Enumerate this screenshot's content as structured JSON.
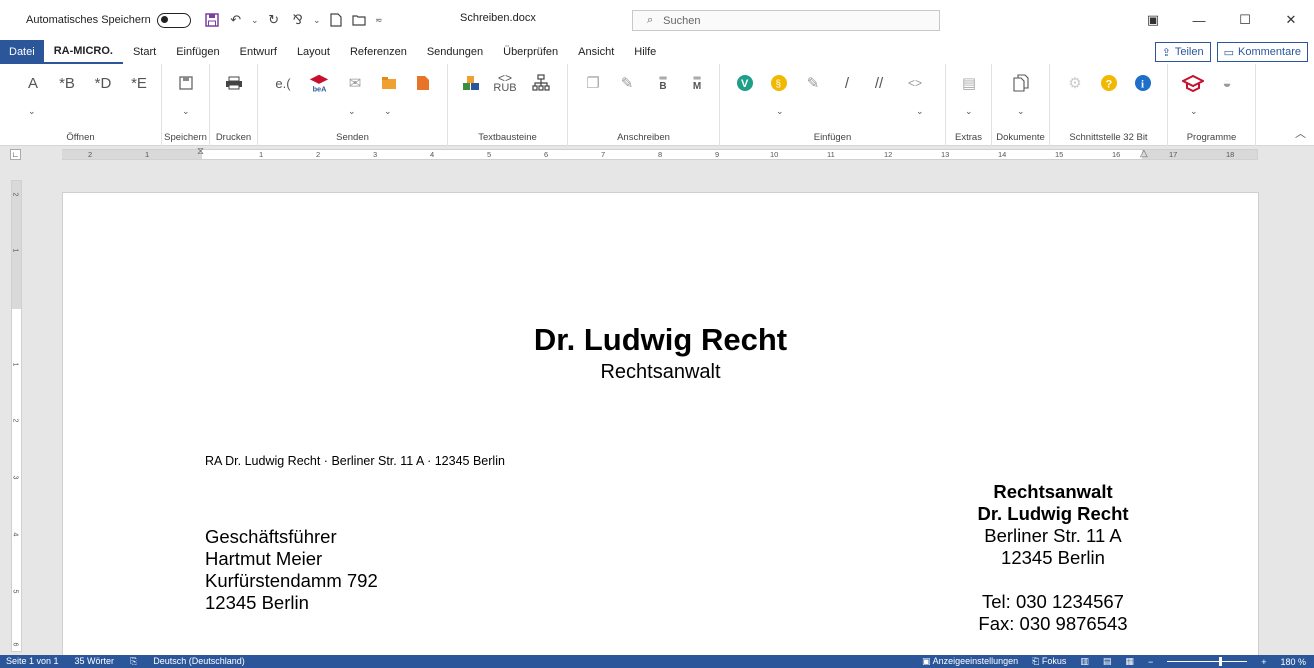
{
  "titlebar": {
    "autosave_label": "Automatisches Speichern",
    "doc_title": "Schreiben.docx",
    "search_placeholder": "Suchen"
  },
  "tabs": [
    {
      "label": "Datei"
    },
    {
      "label": "RA-MICRO."
    },
    {
      "label": "Start"
    },
    {
      "label": "Einfügen"
    },
    {
      "label": "Entwurf"
    },
    {
      "label": "Layout"
    },
    {
      "label": "Referenzen"
    },
    {
      "label": "Sendungen"
    },
    {
      "label": "Überprüfen"
    },
    {
      "label": "Ansicht"
    },
    {
      "label": "Hilfe"
    }
  ],
  "share": {
    "teilen": "Teilen",
    "kommentare": "Kommentare"
  },
  "ribbon": {
    "groups": [
      "Öffnen",
      "Speichern",
      "Drucken",
      "Senden",
      "Textbausteine",
      "Anschreiben",
      "Einfügen",
      "Extras",
      "Dokumente",
      "Schnittstelle 32 Bit",
      "Programme"
    ],
    "oeffnen_icons": [
      "A",
      "*B",
      "*D",
      "*E"
    ],
    "senden_icons": [
      "e.("
    ],
    "textbausteine_icon": "RUB",
    "anschreiben_icons": [
      "B",
      "M"
    ]
  },
  "ruler": {
    "numbers": [
      "2",
      "1",
      "1",
      "2",
      "3",
      "4",
      "5",
      "6",
      "7",
      "8",
      "9",
      "10",
      "11",
      "12",
      "13",
      "14",
      "15",
      "16",
      "17",
      "18"
    ],
    "vertical_numbers": [
      "2",
      "1",
      "1",
      "2",
      "3",
      "4",
      "5",
      "6"
    ]
  },
  "letter": {
    "name": "Dr. Ludwig Recht",
    "subtitle": "Rechtsanwalt",
    "sender_line": "RA Dr. Ludwig Recht · Berliner Str. 11 A · 12345 Berlin",
    "recipient": [
      "Geschäftsführer",
      "Hartmut Meier",
      "Kurfürstendamm 792",
      "12345 Berlin"
    ],
    "sender_block": {
      "title": "Rechtsanwalt",
      "name": "Dr. Ludwig Recht",
      "street": "Berliner Str. 11 A",
      "city": "12345 Berlin",
      "tel": "Tel: 030 1234567",
      "fax": "Fax: 030 9876543"
    }
  },
  "status": {
    "page": "Seite 1 von 1",
    "words": "35 Wörter",
    "language": "Deutsch (Deutschland)",
    "display_settings": "Anzeigeeinstellungen",
    "focus": "Fokus",
    "zoom": "180 %"
  },
  "colors": {
    "accent": "#2b579a",
    "save_icon": "#7b3fa0"
  }
}
